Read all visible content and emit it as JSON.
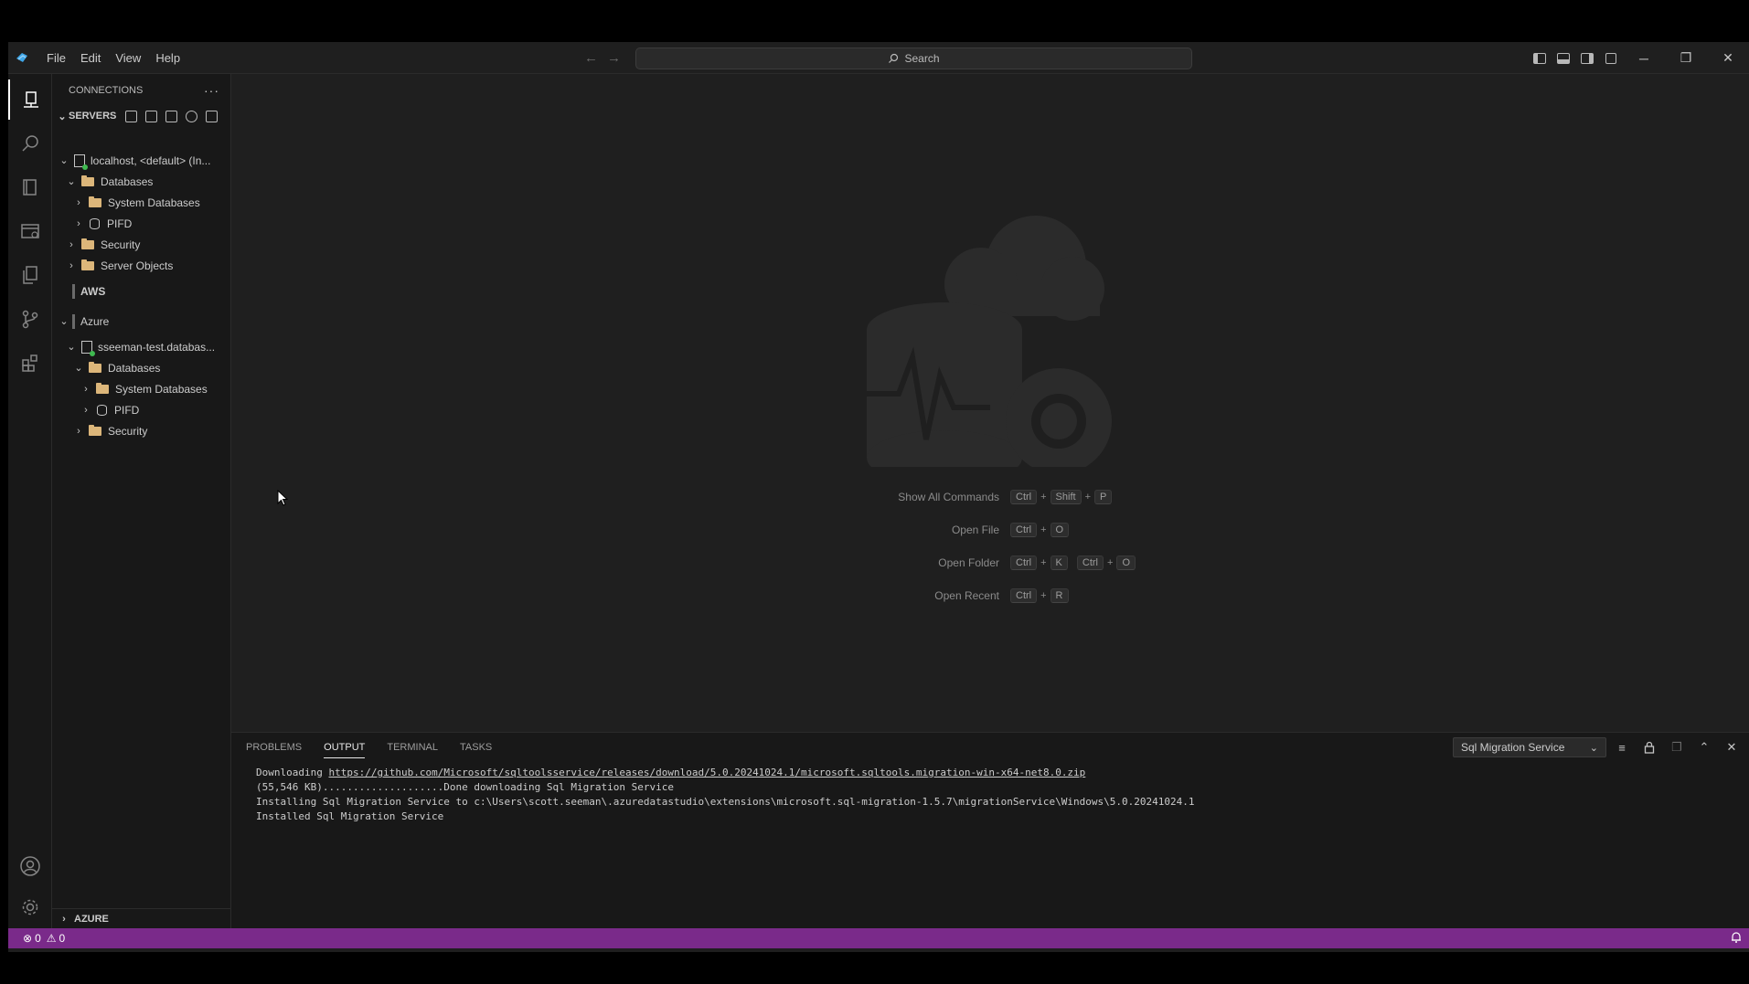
{
  "menu": {
    "file": "File",
    "edit": "Edit",
    "view": "View",
    "help": "Help"
  },
  "search": {
    "label": "Search"
  },
  "sidebar": {
    "title": "CONNECTIONS",
    "servers_label": "SERVERS",
    "tree": [
      {
        "label": "localhost, <default> (In..."
      },
      {
        "label": "Databases"
      },
      {
        "label": "System Databases"
      },
      {
        "label": "PIFD"
      },
      {
        "label": "Security"
      },
      {
        "label": "Server Objects"
      },
      {
        "label": "AWS"
      },
      {
        "label": "Azure"
      },
      {
        "label": "sseeman-test.databas..."
      },
      {
        "label": "Databases"
      },
      {
        "label": "System Databases"
      },
      {
        "label": "PIFD"
      },
      {
        "label": "Security"
      }
    ],
    "footer": "AZURE"
  },
  "welcome": {
    "shortcuts": [
      {
        "label": "Show All Commands",
        "keys": [
          "Ctrl",
          "Shift",
          "P"
        ]
      },
      {
        "label": "Open File",
        "keys": [
          "Ctrl",
          "O"
        ]
      },
      {
        "label": "Open Folder",
        "keys": [
          "Ctrl",
          "K",
          "Ctrl",
          "O"
        ]
      },
      {
        "label": "Open Recent",
        "keys": [
          "Ctrl",
          "R"
        ]
      }
    ]
  },
  "panel": {
    "tabs": [
      "PROBLEMS",
      "OUTPUT",
      "TERMINAL",
      "TASKS"
    ],
    "output_channel": "Sql Migration Service",
    "lines": {
      "l1_prefix": "Downloading ",
      "l1_link": "https://github.com/Microsoft/sqltoolsservice/releases/download/5.0.20241024.1/microsoft.sqltools.migration-win-x64-net8.0.zip",
      "l2": "(55,546 KB)....................Done downloading Sql Migration Service",
      "l3": "Installing Sql Migration Service to c:\\Users\\scott.seeman\\.azuredatastudio\\extensions\\microsoft.sql-migration-1.5.7\\migrationService\\Windows\\5.0.20241024.1",
      "l4": "Installed Sql Migration Service"
    }
  },
  "status": {
    "errors": "0",
    "warnings": "0"
  },
  "colors": {
    "statusbar": "#7a2a8a",
    "accent": "#3ea6e8",
    "folder": "#dcb67a"
  }
}
